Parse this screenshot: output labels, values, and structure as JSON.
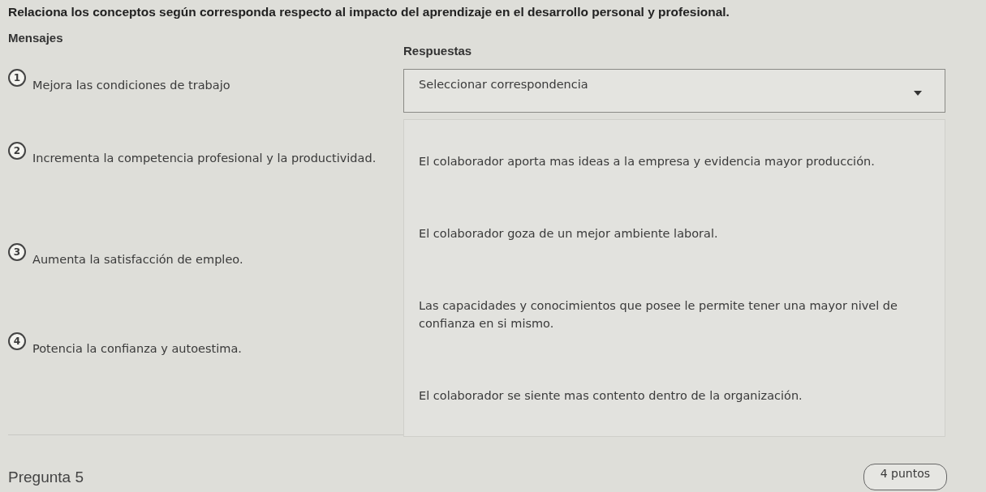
{
  "instruction": "Relaciona los conceptos según corresponda respecto al impacto del aprendizaje en el desarrollo personal y profesional.",
  "headings": {
    "messages": "Mensajes",
    "answers": "Respuestas"
  },
  "messages": [
    {
      "number": "1",
      "text": "Mejora las condiciones de trabajo"
    },
    {
      "number": "2",
      "text": "Incrementa la competencia profesional y la productividad."
    },
    {
      "number": "3",
      "text": "Aumenta la satisfacción de empleo."
    },
    {
      "number": "4",
      "text": "Potencia la confianza y autoestima."
    }
  ],
  "dropdown": {
    "placeholder": "Seleccionar correspondencia",
    "expanded": true,
    "options": [
      {
        "text": "El colaborador aporta mas ideas a la empresa y evidencia mayor producción.",
        "selected": false
      },
      {
        "text": "El colaborador goza de un mejor ambiente laboral.",
        "selected": false
      },
      {
        "text": "Las capacidades y conocimientos que posee le permite tener una mayor nivel de confianza en si mismo.",
        "selected": false
      },
      {
        "text": "El colaborador se siente mas contento dentro de la organización.",
        "selected": false
      }
    ]
  },
  "footer": {
    "question": "Pregunta 5",
    "points": "4 puntos"
  }
}
